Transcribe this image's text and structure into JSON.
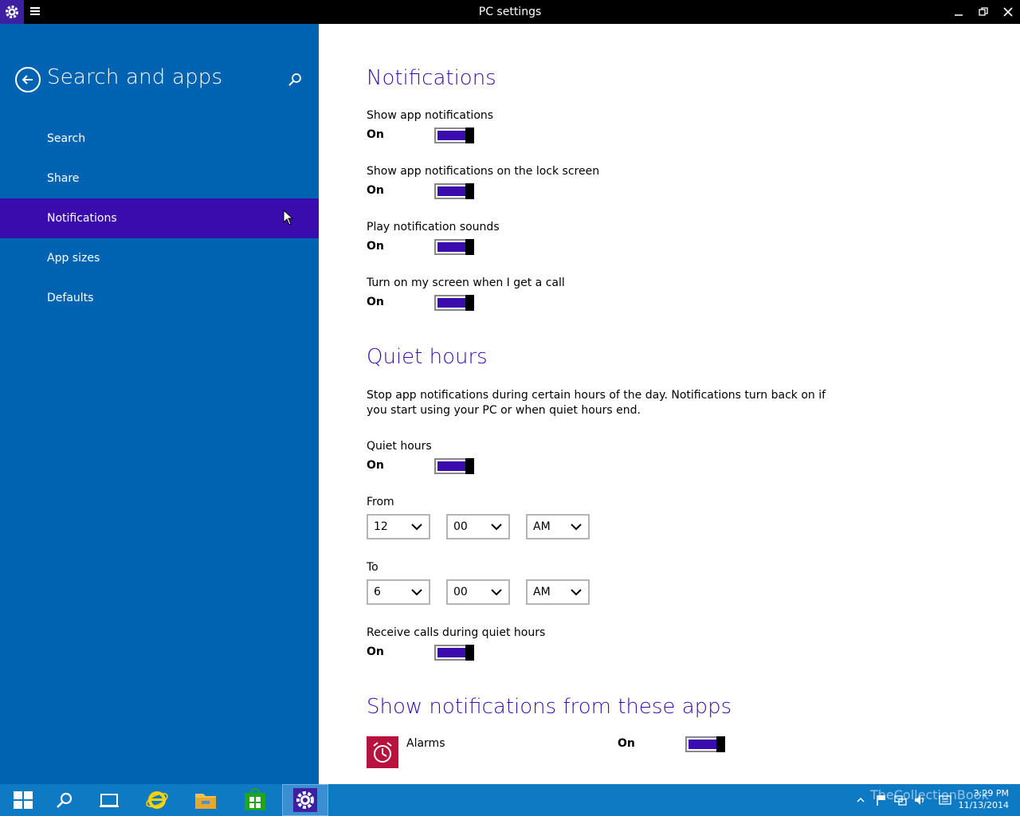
{
  "window": {
    "title": "PC settings"
  },
  "sidebar": {
    "title": "Search and apps",
    "items": [
      {
        "label": "Search"
      },
      {
        "label": "Share"
      },
      {
        "label": "Notifications",
        "selected": true
      },
      {
        "label": "App sizes"
      },
      {
        "label": "Defaults"
      }
    ]
  },
  "notifications": {
    "heading": "Notifications",
    "settings": [
      {
        "label": "Show app notifications",
        "state": "On",
        "on": true
      },
      {
        "label": "Show app notifications on the lock screen",
        "state": "On",
        "on": true
      },
      {
        "label": "Play notification sounds",
        "state": "On",
        "on": true
      },
      {
        "label": "Turn on my screen when I get a call",
        "state": "On",
        "on": true
      }
    ]
  },
  "quiet_hours": {
    "heading": "Quiet hours",
    "description": "Stop app notifications during certain hours of the day. Notifications turn back on if you start using your PC or when quiet hours end.",
    "toggle": {
      "label": "Quiet hours",
      "state": "On",
      "on": true
    },
    "from": {
      "label": "From",
      "hour": "12",
      "minute": "00",
      "period": "AM"
    },
    "to": {
      "label": "To",
      "hour": "6",
      "minute": "00",
      "period": "AM"
    },
    "receive_calls": {
      "label": "Receive calls during quiet hours",
      "state": "On",
      "on": true
    }
  },
  "apps_section": {
    "heading": "Show notifications from these apps",
    "apps": [
      {
        "name": "Alarms",
        "state": "On",
        "on": true,
        "icon": "alarm-clock-icon"
      }
    ]
  },
  "taskbar": {
    "watermark": "TheCollectionBook",
    "time": "3:29 PM",
    "date": "11/13/2014"
  },
  "colors": {
    "accent": "#3a0cae",
    "sidebar": "#0063b1",
    "taskbar": "#0f7ac4",
    "alarms_tile": "#b8123e"
  }
}
